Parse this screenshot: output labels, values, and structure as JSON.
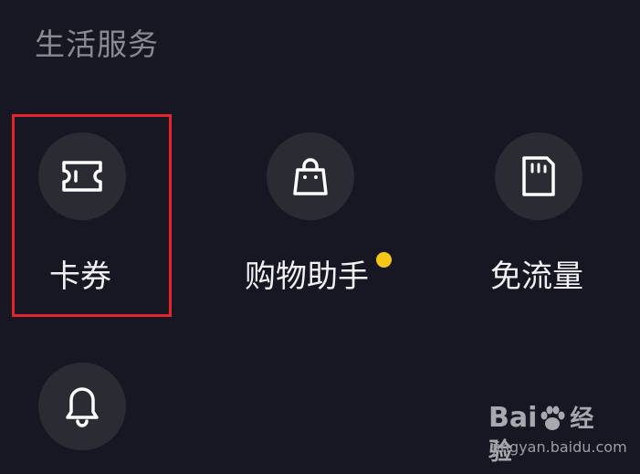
{
  "section": {
    "title": "生活服务"
  },
  "items": [
    {
      "label": "卡券",
      "icon": "ticket-icon"
    },
    {
      "label": "购物助手",
      "icon": "shopping-bag-icon",
      "badge": "new-dot"
    },
    {
      "label": "免流量",
      "icon": "sim-card-icon"
    },
    {
      "label": "",
      "icon": "bell-icon"
    }
  ],
  "watermark": {
    "brand": "Bai",
    "brand_suffix": "经验",
    "url": "jingyan.baidu.com"
  },
  "colors": {
    "background": "#161722",
    "icon_circle": "#2a2b33",
    "highlight": "#e3242b",
    "badge_dot": "#f5c518",
    "section_title": "#8a8b91"
  }
}
